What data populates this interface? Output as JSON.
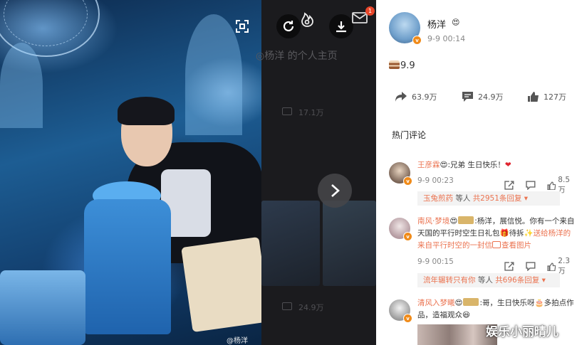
{
  "photo": {
    "watermark": "@杨洋"
  },
  "viewer": {
    "ghost_title": "◎杨洋 的个人主页",
    "ghost_count_top": "17.1万",
    "ghost_count_bottom": "24.9万",
    "notification_count": "1"
  },
  "post": {
    "author": "杨洋",
    "time": "9-9 00:14",
    "body": "9.9",
    "reposts": "63.9万",
    "comments": "24.9万",
    "likes": "127万",
    "hot_comments_label": "热门评论"
  },
  "comments": [
    {
      "name": "王彦霖",
      "text": ":兄弟 生日快乐！",
      "time": "9-9 00:23",
      "likes": "8.5万",
      "reply_user": "玉兔煎药",
      "reply_mid": "等人",
      "reply_count": "共2951条回复"
    },
    {
      "name": "南风·梦境",
      "text_a": ":杨洋，展信悦。你有一个来自天国的平行时空生日礼包",
      "text_b": "待拆",
      "text_c": "送给杨洋的来自平行时空的一封信",
      "text_d": "查看图片",
      "time": "9-9 00:15",
      "likes": "2.3万",
      "reply_user": "流年辗转只有你",
      "reply_mid": "等人",
      "reply_count": "共696条回复"
    },
    {
      "name": "清风入梦曦",
      "text_a": ":哥，生日快乐呀",
      "text_b": "多拍点作品，造福观众"
    }
  ],
  "page_watermark": "娱乐小丽晴儿",
  "colors": {
    "accent": "#eb7350",
    "viewer_bg": "#1b1b1e",
    "vip_badge": "#f08b1a"
  },
  "icons": [
    "scan-icon",
    "rotate-icon",
    "fire-icon",
    "download-icon",
    "mail-icon",
    "next-arrow-icon",
    "repost-icon",
    "comment-icon",
    "like-icon",
    "share-icon",
    "reply-icon",
    "heart-icon"
  ]
}
